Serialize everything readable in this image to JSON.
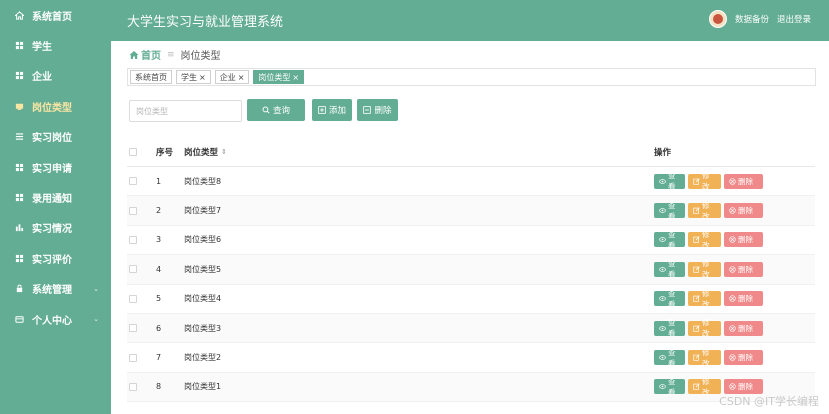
{
  "app_title": "大学生实习与就业管理系统",
  "header": {
    "backup_label": "数据备份",
    "logout_label": "退出登录"
  },
  "sidebar": {
    "items": [
      {
        "label": "系统首页",
        "icon": "home-icon"
      },
      {
        "label": "学生",
        "icon": "grid-icon"
      },
      {
        "label": "企业",
        "icon": "grid-icon"
      },
      {
        "label": "岗位类型",
        "icon": "folder-icon",
        "active": true
      },
      {
        "label": "实习岗位",
        "icon": "list-icon"
      },
      {
        "label": "实习申请",
        "icon": "grid-icon"
      },
      {
        "label": "录用通知",
        "icon": "grid-icon"
      },
      {
        "label": "实习情况",
        "icon": "chart-icon"
      },
      {
        "label": "实习评价",
        "icon": "grid-icon"
      },
      {
        "label": "系统管理",
        "icon": "lock-icon",
        "has_submenu": true
      },
      {
        "label": "个人中心",
        "icon": "card-icon",
        "has_submenu": true
      }
    ]
  },
  "breadcrumb": {
    "home": "首页",
    "current": "岗位类型"
  },
  "tags": [
    {
      "label": "系统首页",
      "closable": false
    },
    {
      "label": "学生",
      "closable": true
    },
    {
      "label": "企业",
      "closable": true
    },
    {
      "label": "岗位类型",
      "closable": true,
      "active": true
    }
  ],
  "search": {
    "placeholder": "岗位类型",
    "query_label": "查询",
    "add_label": "添加",
    "delete_label": "删除"
  },
  "table": {
    "headers": {
      "no": "序号",
      "type": "岗位类型",
      "ops": "操作"
    },
    "rows": [
      {
        "no": "1",
        "type": "岗位类型8"
      },
      {
        "no": "2",
        "type": "岗位类型7"
      },
      {
        "no": "3",
        "type": "岗位类型6"
      },
      {
        "no": "4",
        "type": "岗位类型5"
      },
      {
        "no": "5",
        "type": "岗位类型4"
      },
      {
        "no": "6",
        "type": "岗位类型3"
      },
      {
        "no": "7",
        "type": "岗位类型2"
      },
      {
        "no": "8",
        "type": "岗位类型1"
      }
    ],
    "actions": {
      "view": "查看",
      "edit": "修改",
      "delete": "删除"
    }
  },
  "watermark": "CSDN @IT学长编程",
  "colors": {
    "primary": "#62ad94",
    "active_nav": "#fbe6a4",
    "edit": "#f1b155",
    "delete": "#f08a8a"
  }
}
